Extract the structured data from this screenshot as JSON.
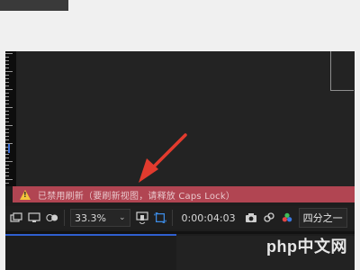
{
  "warning": {
    "message": "已禁用刷新（要刷新视图，请释放 Caps Lock）",
    "color": "#b14552"
  },
  "toolbar": {
    "zoom_value": "33.3%",
    "timecode": "0:00:04:03",
    "resolution": "四分之一"
  },
  "watermark": {
    "text": "php中文网"
  },
  "icons": [
    "snapshot-icon",
    "monitor-icon",
    "mask-icon",
    "region-of-interest-icon",
    "toggle-transparency-icon",
    "camera-icon",
    "channel-icon",
    "color-picker-icon"
  ],
  "colors": {
    "accent_blue": "#2f5fcf",
    "arrow_red": "#e23b2e",
    "warning_icon": "#f4c53b"
  }
}
